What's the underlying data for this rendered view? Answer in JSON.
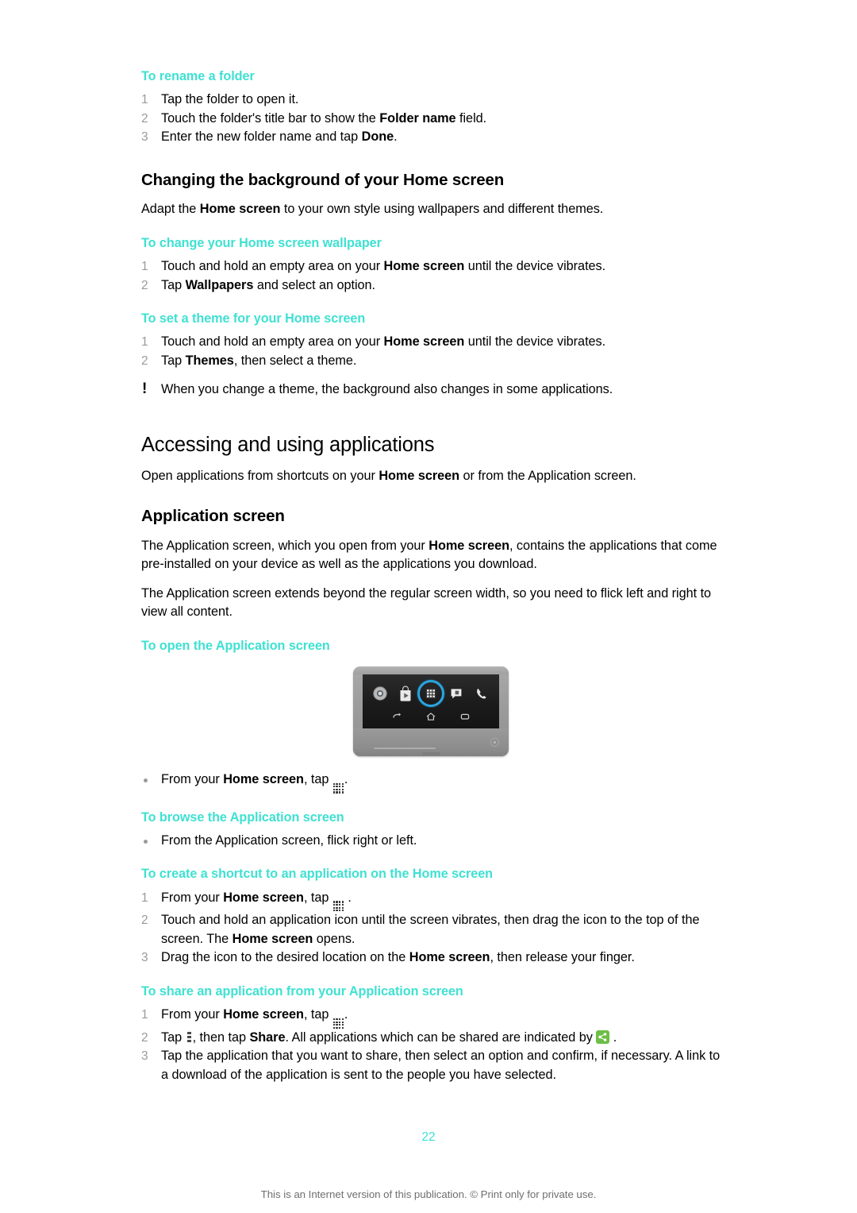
{
  "document": {
    "page_number": "22",
    "footer_note": "This is an Internet version of this publication. © Print only for private use.",
    "accent_color": "#3fe1d2",
    "share_icon_color": "#6cbe45",
    "highlight_ring_color": "#2aa5e0"
  },
  "sections": {
    "rename_folder": {
      "title": "To rename a folder",
      "steps": [
        {
          "num": "1",
          "html": "Tap the folder to open it."
        },
        {
          "num": "2",
          "html": "Touch the folder's title bar to show the <b>Folder name</b> field."
        },
        {
          "num": "3",
          "html": "Enter the new folder name and tap <b>Done</b>."
        }
      ]
    },
    "changing_background": {
      "heading": "Changing the background of your Home screen",
      "intro": "Adapt the <b>Home screen</b> to your own style using wallpapers and different themes.",
      "change_wallpaper": {
        "title": "To change your Home screen wallpaper",
        "steps": [
          {
            "num": "1",
            "html": "Touch and hold an empty area on your <b>Home screen</b> until the device vibrates."
          },
          {
            "num": "2",
            "html": "Tap <b>Wallpapers</b> and select an option."
          }
        ]
      },
      "set_theme": {
        "title": "To set a theme for your Home screen",
        "steps": [
          {
            "num": "1",
            "html": "Touch and hold an empty area on your <b>Home screen</b> until the device vibrates."
          },
          {
            "num": "2",
            "html": "Tap <b>Themes</b>, then select a theme."
          }
        ],
        "note": "When you change a theme, the background also changes in some applications."
      }
    },
    "accessing_apps": {
      "heading": "Accessing and using applications",
      "intro": "Open applications from shortcuts on your <b>Home screen</b> or from the Application screen.",
      "application_screen": {
        "heading": "Application screen",
        "paragraphs": [
          "The Application screen, which you open from your <b>Home screen</b>, contains the applications that come pre-installed on your device as well as the applications you download.",
          "The Application screen extends beyond the regular screen width, so you need to flick left and right to view all content."
        ]
      },
      "open_app_screen": {
        "title": "To open the Application screen",
        "bullets": [
          {
            "html": "From your <b>Home screen</b>, tap <span class=\"ico-appgrid\" data-name=\"app-grid-icon\" data-interactable=\"false\"><span class=\"g\"><i></i><i></i><i></i><i></i><i></i><i></i><i></i><i></i><i></i><i></i><i></i><i></i><i></i><i></i><i></i><i></i></span></span>."
          }
        ]
      },
      "browse_app_screen": {
        "title": "To browse the Application screen",
        "bullets": [
          {
            "html": "From the Application screen, flick right or left."
          }
        ]
      },
      "create_shortcut": {
        "title": "To create a shortcut to an application on the Home screen",
        "steps": [
          {
            "num": "1",
            "html": "From your <b>Home screen</b>, tap <span class=\"ico-appgrid\" data-name=\"app-grid-icon\" data-interactable=\"false\"><span class=\"g\"><i></i><i></i><i></i><i></i><i></i><i></i><i></i><i></i><i></i><i></i><i></i><i></i><i></i><i></i><i></i><i></i></span></span> ."
          },
          {
            "num": "2",
            "html": "Touch and hold an application icon until the screen vibrates, then drag the icon to the top of the screen. The <b>Home screen</b> opens."
          },
          {
            "num": "3",
            "html": "Drag the icon to the desired location on the <b>Home screen</b>, then release your finger."
          }
        ]
      },
      "share_app": {
        "title": "To share an application from your Application screen",
        "steps": [
          {
            "num": "1",
            "html": "From your <b>Home screen</b>, tap <span class=\"ico-appgrid\" data-name=\"app-grid-icon\" data-interactable=\"false\"><span class=\"g\"><i></i><i></i><i></i><i></i><i></i><i></i><i></i><i></i><i></i><i></i><i></i><i></i><i></i><i></i><i></i><i></i></span></span>."
          },
          {
            "num": "2",
            "html": "Tap <span class=\"ico-dots\" data-name=\"overflow-menu-icon\" data-interactable=\"false\"><i></i><i></i><i></i></span>, then tap <b>Share</b>. All applications which can be shared are indicated by <span class=\"ico-share\" data-name=\"share-icon\" data-interactable=\"false\"><svg width=\"17\" height=\"17\" viewBox=\"0 0 17 17\"><circle cx=\"11.6\" cy=\"4.9\" r=\"1.7\" fill=\"#ffffff\"/><circle cx=\"11.6\" cy=\"12.1\" r=\"1.7\" fill=\"#ffffff\"/><circle cx=\"5.2\" cy=\"8.5\" r=\"1.9\" fill=\"#ffffff\"/><path d=\"M6.2 7.6 L10.6 5.3 M6.2 9.4 L10.6 11.7\" stroke=\"#ffffff\" stroke-width=\"1.1\" fill=\"none\"/></svg></span> ."
          },
          {
            "num": "3",
            "html": "Tap the application that you want to share, then select an option and confirm, if necessary. A link to a download of the application is sent to the people you have selected."
          }
        ]
      }
    }
  },
  "phone_figure": {
    "caption": "",
    "dock_icons": [
      "browser-icon",
      "play-store-icon",
      "app-grid-icon",
      "messaging-icon",
      "phone-icon"
    ],
    "nav_icons": [
      "back-icon",
      "home-icon",
      "recents-icon"
    ],
    "highlighted_icon": "app-grid-icon"
  }
}
